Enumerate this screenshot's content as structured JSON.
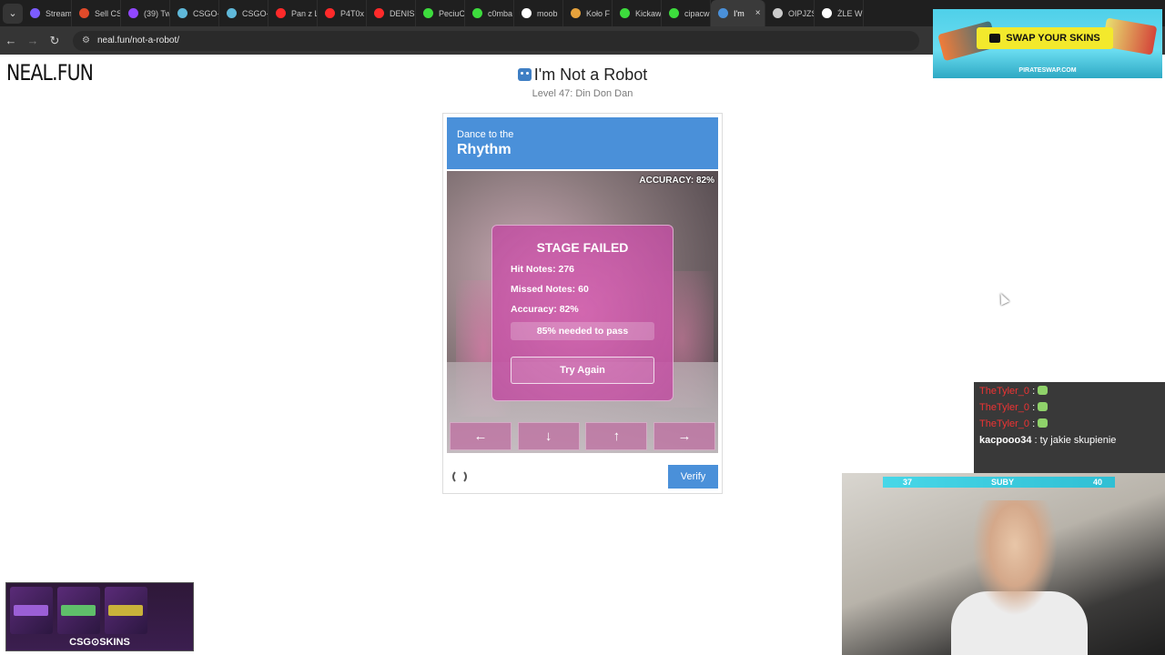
{
  "browser": {
    "tabs": [
      {
        "label": "Stream",
        "color": "#7c5cff"
      },
      {
        "label": "Sell CS",
        "color": "#e04a2a"
      },
      {
        "label": "(39) Tw",
        "color": "#9147ff"
      },
      {
        "label": "CSGO-",
        "color": "#5fb8d9"
      },
      {
        "label": "CSGO-",
        "color": "#5fb8d9"
      },
      {
        "label": "Pan z L",
        "color": "#ff2a2a"
      },
      {
        "label": "P4T0x",
        "color": "#ff2a2a"
      },
      {
        "label": "DENIS",
        "color": "#ff2a2a"
      },
      {
        "label": "PeciuC",
        "color": "#3ddc3d"
      },
      {
        "label": "c0mba",
        "color": "#3ddc3d"
      },
      {
        "label": "moob",
        "color": "#ffffff"
      },
      {
        "label": "Koło F",
        "color": "#e6a23c"
      },
      {
        "label": "Kickaw",
        "color": "#3ddc3d"
      },
      {
        "label": "cipacw",
        "color": "#3ddc3d"
      },
      {
        "label": "I'm",
        "color": "#4a90d9",
        "active": true
      },
      {
        "label": "OIPJZS",
        "color": "#cccccc"
      },
      {
        "label": "ŻLE W",
        "color": "#ffffff"
      }
    ],
    "tab_close": "×",
    "url": "neal.fun/not-a-robot/",
    "nav": {
      "back": "←",
      "forward": "→",
      "reload": "↻",
      "menu": "⌄",
      "site_info": "⚙"
    }
  },
  "page": {
    "logo": "NEAL.FUN",
    "title": "I'm Not a Robot",
    "level": "Level 47: Din Don Dan"
  },
  "captcha": {
    "subtitle": "Dance to the",
    "heading": "Rhythm",
    "accuracy_badge": "ACCURACY: 82%",
    "result": {
      "title": "STAGE FAILED",
      "hit_notes": "Hit Notes: 276",
      "missed_notes": "Missed Notes: 60",
      "accuracy": "Accuracy: 82%",
      "needed": "85% needed to pass",
      "try_again": "Try Again"
    },
    "arrows": [
      "←",
      "↓",
      "↑",
      "→"
    ],
    "verify": "Verify"
  },
  "overlays": {
    "ad": {
      "button": "SWAP YOUR SKINS",
      "url": "PIRATESWAP.COM"
    },
    "chat": [
      {
        "user": "TheTyler_0",
        "sep": " : ",
        "text": ""
      },
      {
        "user": "TheTyler_0",
        "sep": " : ",
        "text": ""
      },
      {
        "user": "TheTyler_0",
        "sep": " : ",
        "text": ""
      },
      {
        "user": "kacpooo34",
        "sep": " : ",
        "text": "ty jakie skupienie"
      }
    ],
    "sub_bar": {
      "left": "37",
      "label": "SUBY",
      "right": "40"
    },
    "skins_banner": {
      "label": "CSG⊙SKINS",
      "cards": [
        "#9b5fd6",
        "#5fbf6a",
        "#c9b23a"
      ]
    }
  }
}
